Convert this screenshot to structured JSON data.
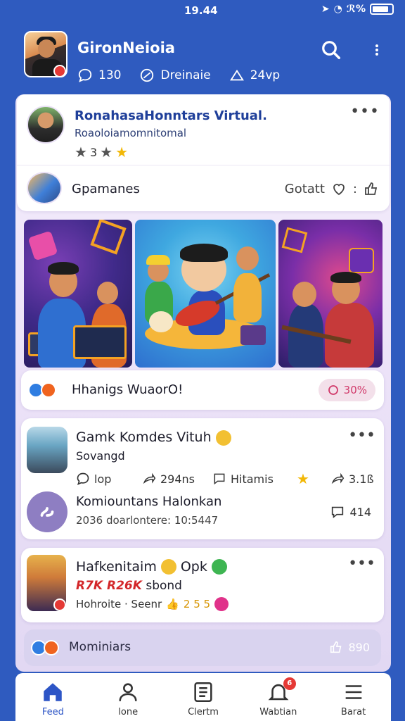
{
  "status": {
    "time": "19.44",
    "signal": "ℛ%"
  },
  "header": {
    "name": "GironNeioia",
    "stats": [
      {
        "label": "130",
        "icon": "chat-bubble-icon"
      },
      {
        "label": "Dreinaie",
        "icon": "leaf-icon"
      },
      {
        "label": "24vp",
        "icon": "share-icon"
      }
    ]
  },
  "card1": {
    "title": "RonahasaHonntars Virtual.",
    "subtitle": "Roaoloiamomnitomal",
    "rating": "3",
    "group_label": "Gpamanes",
    "group_action": "Gotatt",
    "group_action_sep": ":"
  },
  "audio": {
    "label": "Hhanigs  WuaorO!",
    "pill": "30%"
  },
  "card2": {
    "title": "Gamk Komdes Vituh",
    "subtitle": "Sovangd",
    "stats": {
      "comments": "lop",
      "views": "294ns",
      "tags": "Hitamis",
      "shares": "3.1ß"
    },
    "community_title": "Komiountans Halonkan",
    "community_sub": "2036 doarlontere: 10:5447",
    "community_count": "414"
  },
  "card3": {
    "title_a": "Hafkenitaim",
    "title_b": "Opk",
    "line2_red": "R7K R26K",
    "line2_rest": "sbond",
    "line3": "Hohroite · Seenr",
    "line3_count": "2 5 5"
  },
  "bottom": {
    "label": "Mominiars",
    "count": "890"
  },
  "tabs": [
    {
      "label": "Feed",
      "icon": "home-icon",
      "active": true
    },
    {
      "label": "lone",
      "icon": "person-icon"
    },
    {
      "label": "Clertm",
      "icon": "list-icon"
    },
    {
      "label": "Wabtian",
      "icon": "bell-icon",
      "badge": "6"
    },
    {
      "label": "Barat",
      "icon": "menu-icon"
    }
  ],
  "colors": {
    "primary": "#2f5bbf",
    "accent_red": "#e53935",
    "star_gold": "#f2b807",
    "pill_pink": "#d13a6a"
  }
}
